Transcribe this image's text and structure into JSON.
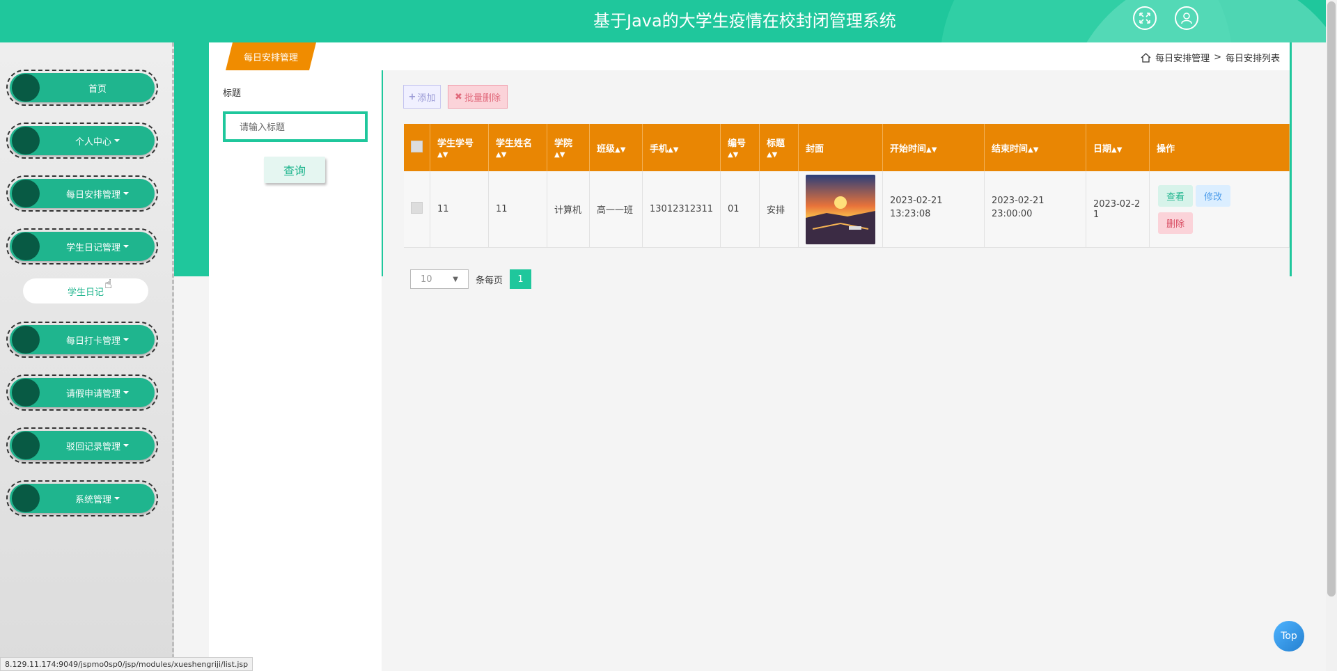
{
  "header": {
    "title": "基于Java的大学生疫情在校封闭管理系统"
  },
  "sidebar": {
    "items": [
      {
        "label": "首页",
        "caret": false
      },
      {
        "label": "个人中心",
        "caret": true
      },
      {
        "label": "每日安排管理",
        "caret": true
      },
      {
        "label": "学生日记管理",
        "caret": true
      },
      {
        "label": "每日打卡管理",
        "caret": true
      },
      {
        "label": "请假申请管理",
        "caret": true
      },
      {
        "label": "驳回记录管理",
        "caret": true
      },
      {
        "label": "系统管理",
        "caret": true
      }
    ],
    "submenu": {
      "label": "学生日记"
    }
  },
  "tabs": {
    "active": "每日安排管理"
  },
  "breadcrumb": {
    "first": "每日安排管理",
    "separator": ">",
    "second": "每日安排列表"
  },
  "search": {
    "label": "标题",
    "placeholder": "请输入标题",
    "button": "查询"
  },
  "toolbar": {
    "add": "添加",
    "batch_delete": "批量删除"
  },
  "table": {
    "columns": [
      "学生学号",
      "学生姓名",
      "学院",
      "班级",
      "手机",
      "编号",
      "标题",
      "封面",
      "开始时间",
      "结束时间",
      "日期",
      "操作"
    ],
    "rows": [
      {
        "student_id": "11",
        "student_name": "11",
        "college": "计算机",
        "class": "高一一班",
        "phone": "13012312311",
        "number": "01",
        "title": "安排",
        "start_date": "2023-02-21",
        "start_time": "13:23:08",
        "end_date": "2023-02-21",
        "end_time": "23:00:00",
        "date": "2023-02-21",
        "actions": {
          "view": "查看",
          "edit": "修改",
          "delete": "删除"
        }
      }
    ]
  },
  "pagination": {
    "page_size": "10",
    "per_page_label": "条每页",
    "current_page": "1"
  },
  "back_to_top": "Top",
  "status_url": "8.129.11.174:9049/jspmo0sp0/jsp/modules/xueshengriji/list.jsp",
  "colors": {
    "primary": "#1fc79c",
    "table_header": "#e98603",
    "sidebar_knob": "#085a44"
  }
}
